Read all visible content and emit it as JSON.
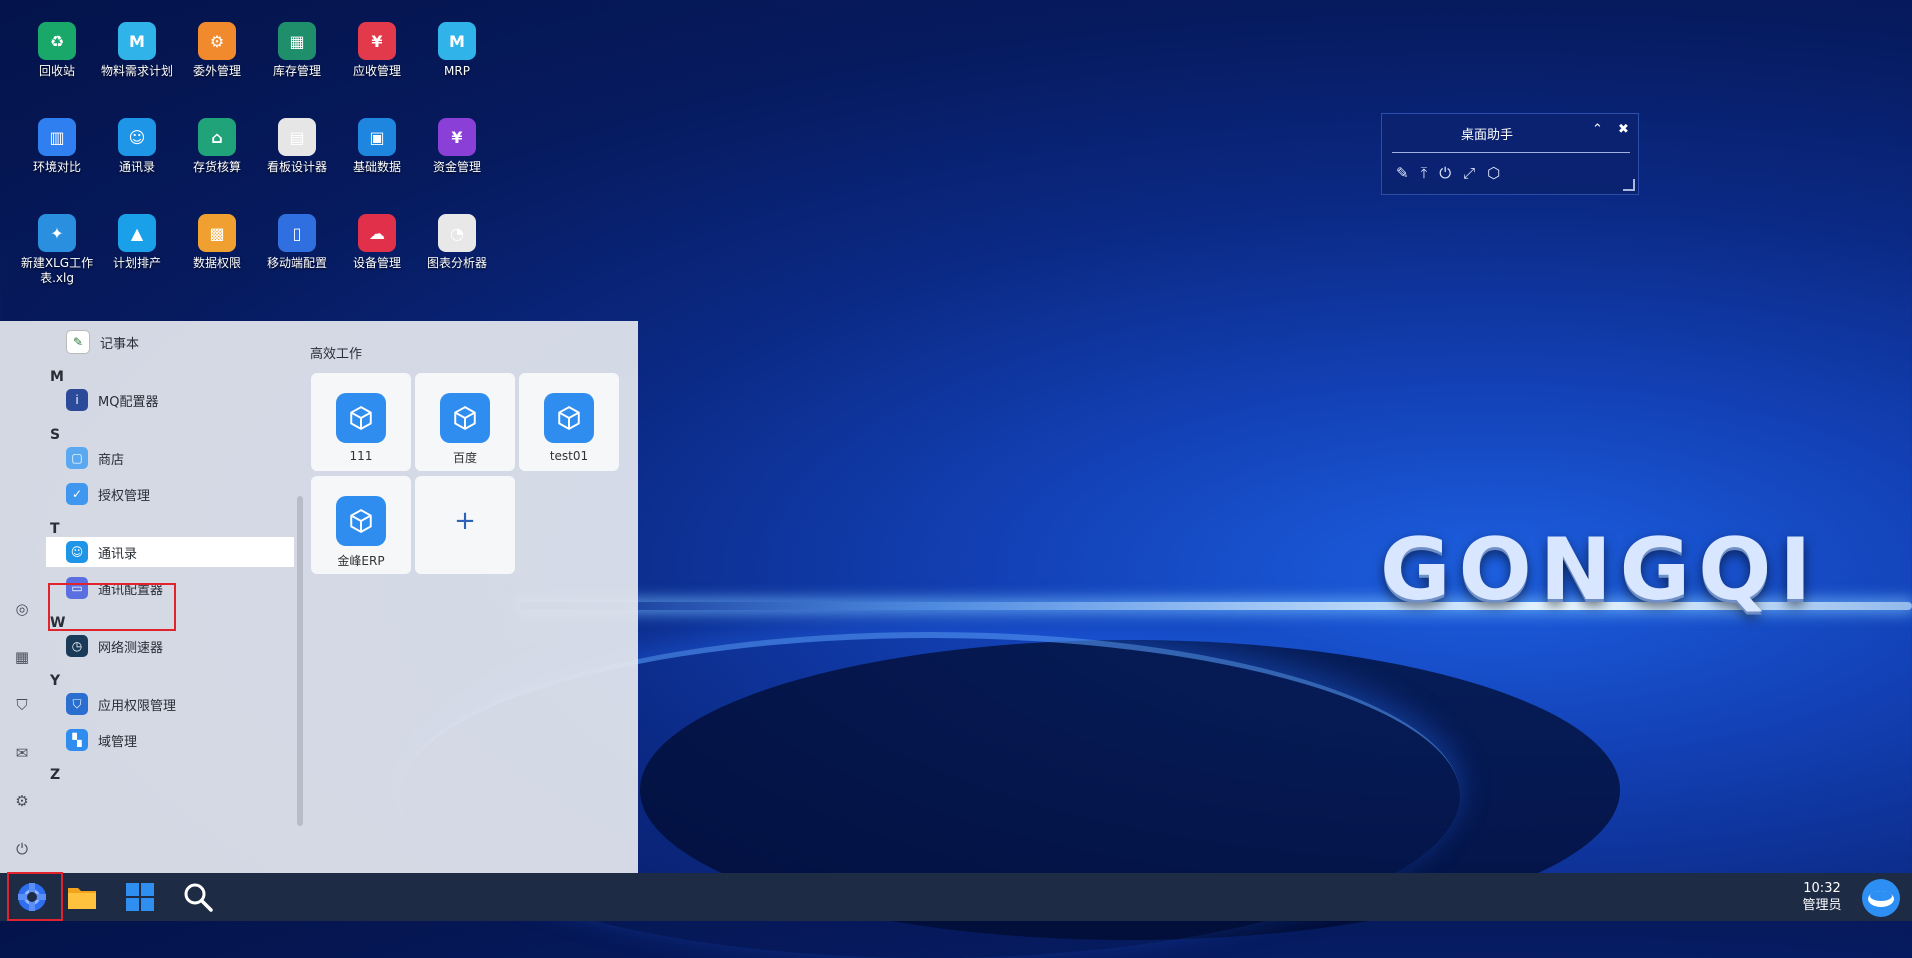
{
  "wallpaper": {
    "brand_text": "GONGQI"
  },
  "desktop_icons": [
    {
      "label": "回收站",
      "glyph": "♻",
      "color": "#19a86a",
      "row": 0,
      "col": 0,
      "shortcut": false
    },
    {
      "label": "物料需求计划",
      "glyph": "M",
      "color": "#2fb3e8",
      "row": 0,
      "col": 1,
      "shortcut": true
    },
    {
      "label": "委外管理",
      "glyph": "⚙",
      "color": "#f08a2c",
      "row": 0,
      "col": 2,
      "shortcut": true
    },
    {
      "label": "库存管理",
      "glyph": "▦",
      "color": "#1f8f6b",
      "row": 0,
      "col": 3,
      "shortcut": true
    },
    {
      "label": "应收管理",
      "glyph": "¥",
      "color": "#e23a4a",
      "row": 0,
      "col": 4,
      "shortcut": true
    },
    {
      "label": "MRP",
      "glyph": "M",
      "color": "#2fb3e8",
      "row": 0,
      "col": 5,
      "shortcut": true
    },
    {
      "label": "环境对比",
      "glyph": "▥",
      "color": "#2f7ff0",
      "row": 1,
      "col": 0,
      "shortcut": false
    },
    {
      "label": "通讯录",
      "glyph": "☺",
      "color": "#1e95e6",
      "row": 1,
      "col": 1,
      "shortcut": true
    },
    {
      "label": "存货核算",
      "glyph": "⌂",
      "color": "#21a37a",
      "row": 1,
      "col": 2,
      "shortcut": true
    },
    {
      "label": "看板设计器",
      "glyph": "▤",
      "color": "#e6e6e6",
      "row": 1,
      "col": 3,
      "shortcut": true
    },
    {
      "label": "基础数据",
      "glyph": "▣",
      "color": "#1f86e0",
      "row": 1,
      "col": 4,
      "shortcut": true
    },
    {
      "label": "资金管理",
      "glyph": "¥",
      "color": "#8a3fd6",
      "row": 1,
      "col": 5,
      "shortcut": true
    },
    {
      "label": "新建XLG工作表.xlg",
      "glyph": "✦",
      "color": "#2b8fe0",
      "row": 2,
      "col": 0,
      "shortcut": false
    },
    {
      "label": "计划排产",
      "glyph": "▲",
      "color": "#1aa0e8",
      "row": 2,
      "col": 1,
      "shortcut": true
    },
    {
      "label": "数据权限",
      "glyph": "▩",
      "color": "#f0a030",
      "row": 2,
      "col": 2,
      "shortcut": true
    },
    {
      "label": "移动端配置",
      "glyph": "▯",
      "color": "#2f6fe0",
      "row": 2,
      "col": 3,
      "shortcut": true
    },
    {
      "label": "设备管理",
      "glyph": "☁",
      "color": "#e0304a",
      "row": 2,
      "col": 4,
      "shortcut": true
    },
    {
      "label": "图表分析器",
      "glyph": "◔",
      "color": "#e8e8e8",
      "row": 2,
      "col": 5,
      "shortcut": true
    }
  ],
  "helper_widget": {
    "title": "桌面助手",
    "collapse_glyph": "⌃",
    "close_glyph": "✖",
    "tools": [
      "✎",
      "⤒",
      "⏻",
      "⤢",
      "⬡"
    ]
  },
  "start_menu": {
    "rail_icons": [
      "user-icon",
      "apps-icon",
      "shield-icon",
      "inbox-icon",
      "settings-icon",
      "power-icon"
    ],
    "rail_glyphs": [
      "◎",
      "▦",
      "⛉",
      "✉",
      "⚙",
      "⏻"
    ],
    "sections": [
      {
        "letter": "",
        "items": [
          {
            "label": "记事本",
            "glyph": "✎",
            "color": "#ffffff"
          }
        ]
      },
      {
        "letter": "M",
        "items": [
          {
            "label": "MQ配置器",
            "glyph": "i",
            "color": "#2c4a9a"
          }
        ]
      },
      {
        "letter": "S",
        "items": [
          {
            "label": "商店",
            "glyph": "▢",
            "color": "#5aa8f0"
          },
          {
            "label": "授权管理",
            "glyph": "✓",
            "color": "#3f97ef"
          }
        ]
      },
      {
        "letter": "T",
        "items": [
          {
            "label": "通讯录",
            "glyph": "☺",
            "color": "#1e95e6",
            "highlighted": true
          },
          {
            "label": "通讯配置器",
            "glyph": "▭",
            "color": "#5a6fe0"
          }
        ]
      },
      {
        "letter": "W",
        "items": [
          {
            "label": "网络测速器",
            "glyph": "◷",
            "color": "#1a3a5a"
          }
        ]
      },
      {
        "letter": "Y",
        "items": [
          {
            "label": "应用权限管理",
            "glyph": "⛉",
            "color": "#2a6fd0"
          },
          {
            "label": "域管理",
            "glyph": "▚",
            "color": "#2f8df0"
          }
        ]
      },
      {
        "letter": "Z",
        "items": []
      }
    ],
    "tiles_title": "高效工作",
    "tiles": [
      {
        "label": "111"
      },
      {
        "label": "百度"
      },
      {
        "label": "test01"
      },
      {
        "label": "金峰ERP"
      }
    ],
    "add_tile_glyph": "+"
  },
  "taskbar": {
    "clock_time": "10:32",
    "clock_user": "管理员"
  }
}
